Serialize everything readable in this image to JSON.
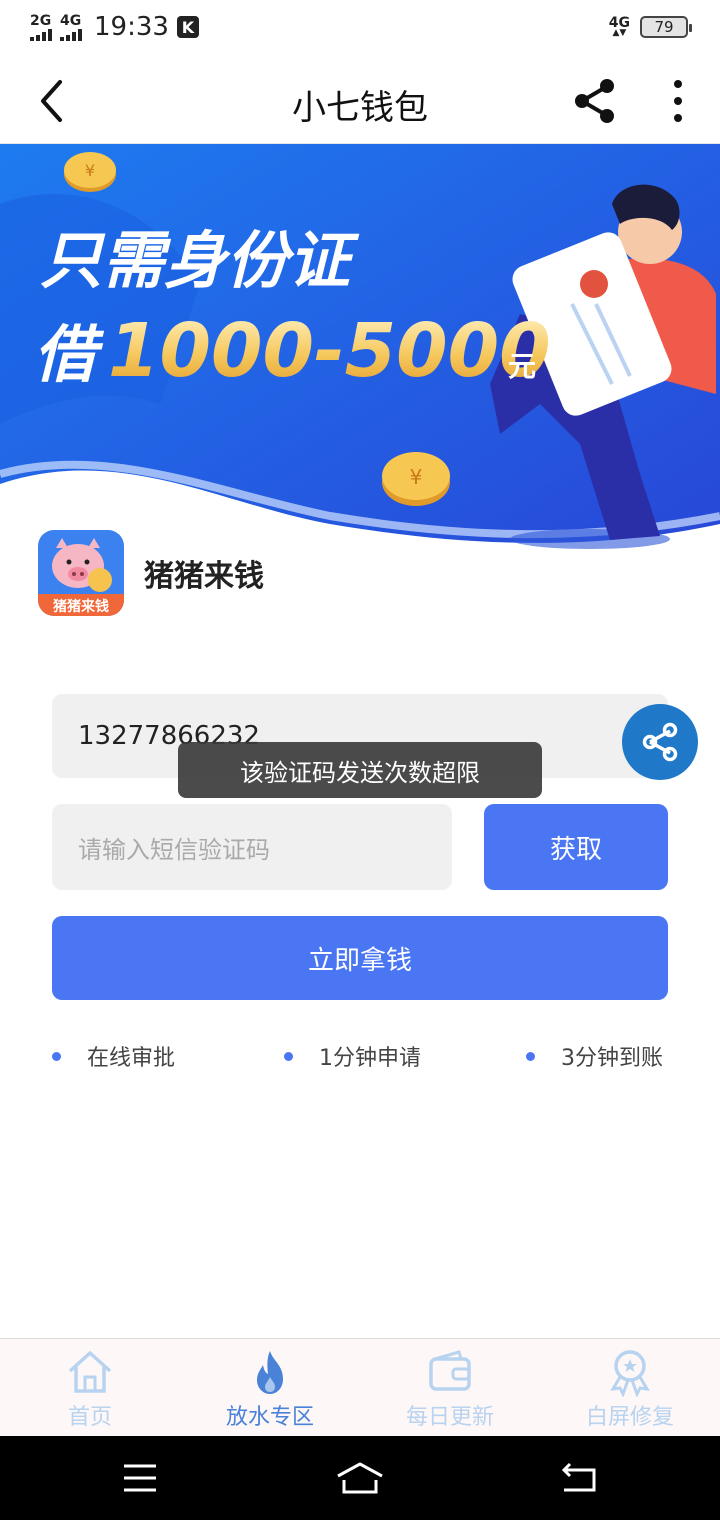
{
  "status_bar": {
    "signal1_label": "2G",
    "signal2_label": "4G",
    "time": "19:33",
    "k_badge": "K",
    "net_label": "4G",
    "battery": "79"
  },
  "app_bar": {
    "title": "小七钱包",
    "back_icon": "back-arrow-icon",
    "share_icon": "share-icon",
    "more_icon": "more-vertical-icon"
  },
  "banner": {
    "line1": "只需身份证",
    "line2_prefix": "借",
    "line2_amount": "1000-5000",
    "line2_unit": "元",
    "colors": {
      "bg_top": "#1f6fea",
      "bg_bottom": "#2a4fd8",
      "gold": "#f5c65a"
    }
  },
  "app_card": {
    "name": "猪猪来钱",
    "icon_label": "猪猪来钱"
  },
  "form": {
    "phone_value": "13277866232",
    "code_placeholder": "请输入短信验证码",
    "get_code_label": "获取",
    "submit_label": "立即拿钱"
  },
  "toast": {
    "message": "该验证码发送次数超限"
  },
  "features": [
    {
      "label": "在线审批"
    },
    {
      "label": "1分钟申请"
    },
    {
      "label": "3分钟到账"
    }
  ],
  "tabs": [
    {
      "label": "首页",
      "icon": "home-icon",
      "active": false
    },
    {
      "label": "放水专区",
      "icon": "flame-icon",
      "active": true
    },
    {
      "label": "每日更新",
      "icon": "wallet-icon",
      "active": false
    },
    {
      "label": "白屏修复",
      "icon": "award-icon",
      "active": false
    }
  ],
  "nav": {
    "menu_icon": "menu-icon",
    "home_icon": "home-outline-icon",
    "back_icon": "return-icon"
  },
  "colors": {
    "accent": "#4a76f4",
    "float_share": "#1f78c8",
    "tab_active": "#4a82d8",
    "tab_inactive": "#b8d3f0"
  }
}
